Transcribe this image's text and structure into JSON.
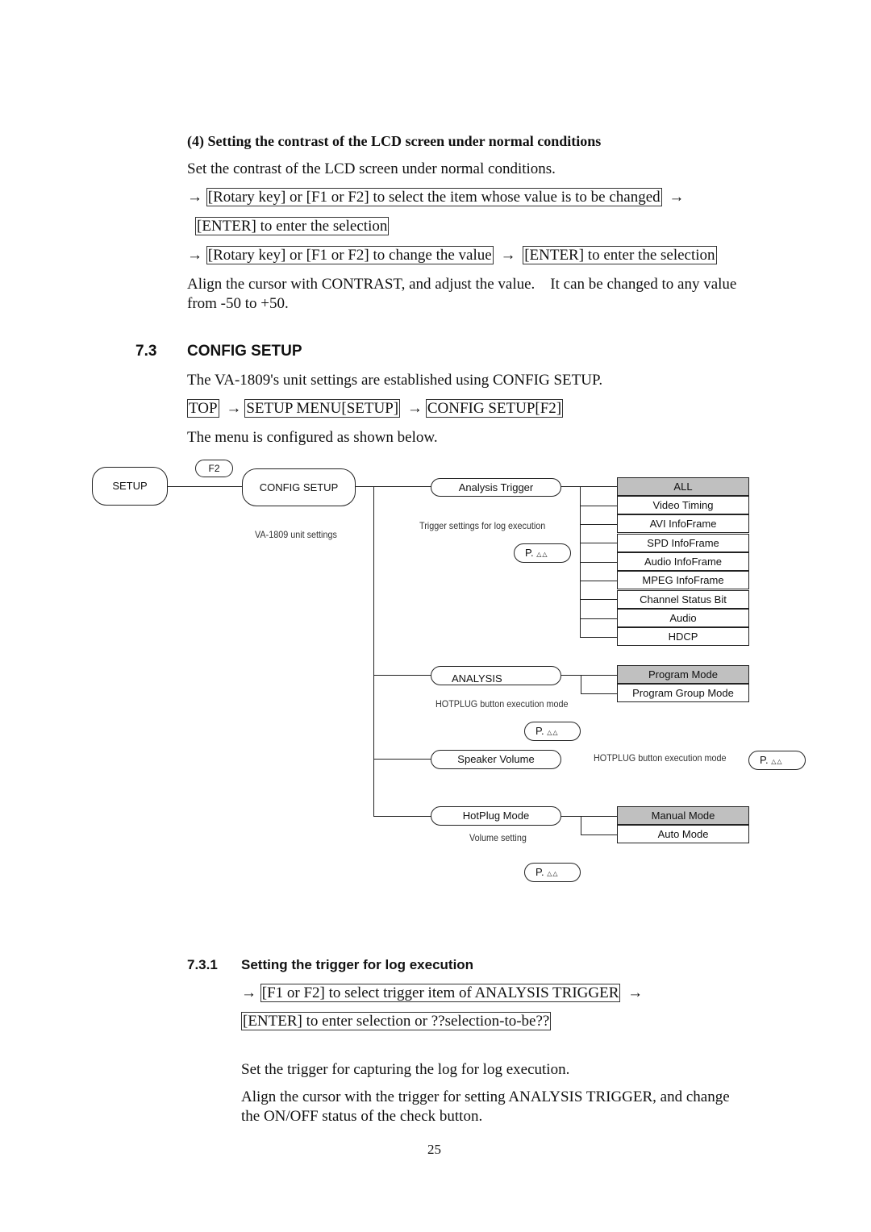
{
  "section4": {
    "heading": "(4)  Setting the contrast of the LCD screen under normal conditions",
    "intro": "Set the contrast of the LCD screen under normal conditions.",
    "arrow": "→",
    "step1_box": "[Rotary key] or [F1 or F2] to select the item whose value is to be changed",
    "step1_enter_box": "[ENTER] to enter the selection",
    "step2_box": "[Rotary key] or [F1 or F2] to change the value",
    "step2_enter_box": "[ENTER] to enter the selection",
    "desc_line1": "Align the cursor with CONTRAST, and adjust the value.    It can be changed to any value",
    "desc_line2": "from -50 to +50."
  },
  "section73": {
    "number": "7.3",
    "title": "CONFIG SETUP",
    "intro": "The VA-1809's unit settings are established using CONFIG SETUP.",
    "nav": [
      "TOP",
      "SETUP MENU[SETUP]",
      "CONFIG SETUP[F2]"
    ],
    "arrow": "→",
    "menu_note": "The menu is configured as shown below."
  },
  "diagram": {
    "setup": "SETUP",
    "f2_key": "F2",
    "config_setup": "CONFIG SETUP",
    "config_note": "VA-1809 unit settings",
    "page_ref": "P.",
    "page_marks": "△△",
    "analysis_trigger": {
      "label": "Analysis Trigger",
      "note": "Trigger settings for log execution",
      "options": [
        "ALL",
        "Video Timing",
        "AVI InfoFrame",
        "SPD InfoFrame",
        "Audio InfoFrame",
        "MPEG InfoFrame",
        "Channel Status Bit",
        "Audio",
        "HDCP"
      ],
      "selected": "ALL"
    },
    "analysis": {
      "label": "ANALYSIS",
      "note": "HOTPLUG button execution mode",
      "options": [
        "Program Mode",
        "Program Group Mode"
      ],
      "selected": "Program Mode"
    },
    "speaker_volume": {
      "label": "Speaker Volume",
      "note": "HOTPLUG button execution mode"
    },
    "hotplug_mode": {
      "label": "HotPlug Mode",
      "note": "Volume setting",
      "options": [
        "Manual Mode",
        "Auto Mode"
      ],
      "selected": "Manual Mode"
    }
  },
  "section731": {
    "number": "7.3.1",
    "title": "Setting the trigger for log execution",
    "arrow": "→",
    "step_box": "[F1 or F2] to select trigger item of ANALYSIS TRIGGER",
    "enter_box": "[ENTER] to enter selection or ??selection-to-be??",
    "para1": "Set the trigger for capturing the log for log execution.",
    "para2_line1": "Align the cursor with the trigger for setting ANALYSIS TRIGGER, and change",
    "para2_line2": "the ON/OFF status of the check button."
  },
  "page_number": "25"
}
